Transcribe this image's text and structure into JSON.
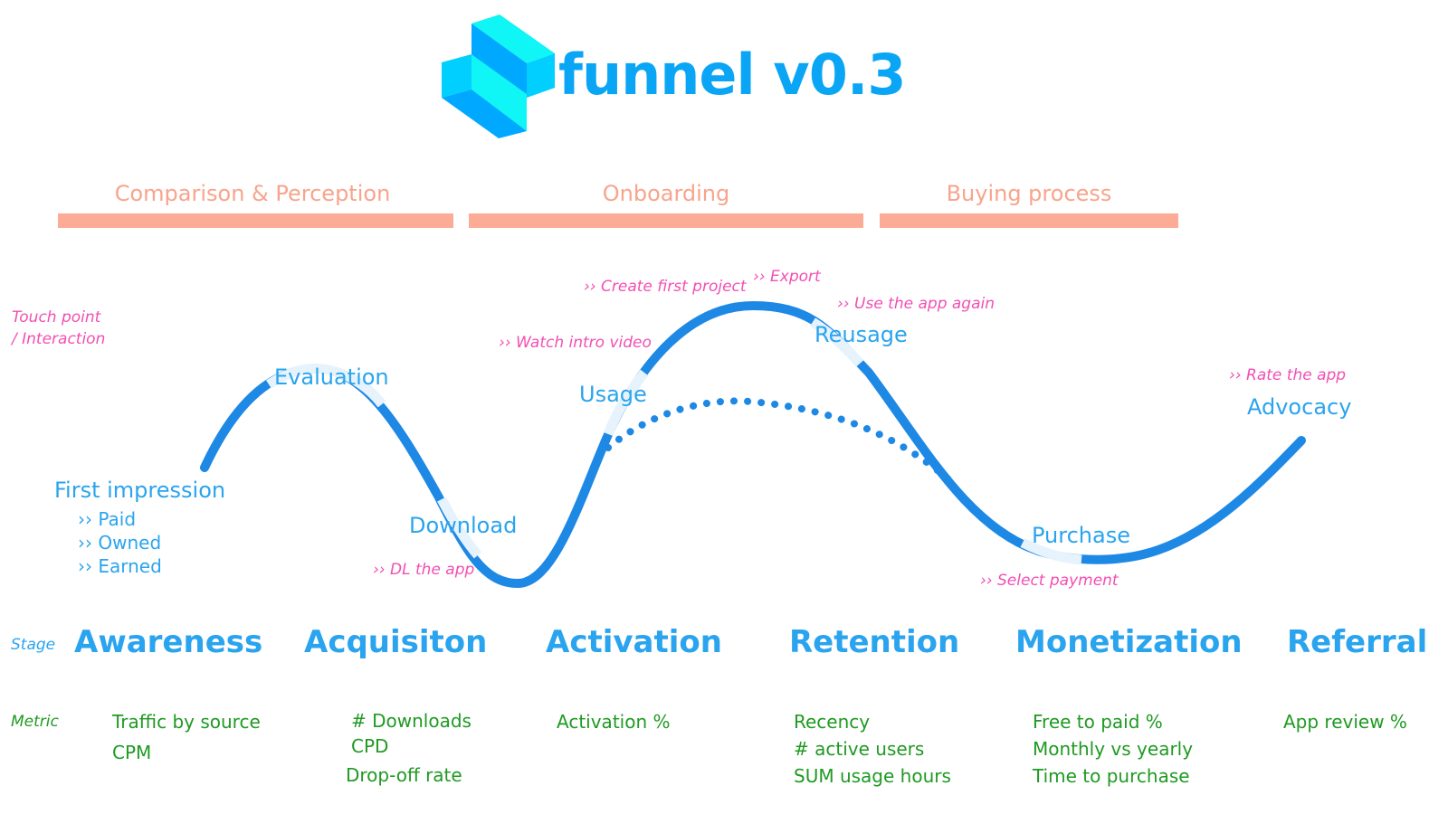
{
  "header": {
    "title": "funnel v0.3",
    "logo_icon": "isometric-blocks-logo"
  },
  "colors": {
    "curve": "#1e88e5",
    "label": "#2aa4ee",
    "touchpoint": "#f24fb4",
    "metric": "#1f9a22",
    "phase": "#fbab96"
  },
  "phases": [
    {
      "label": "Comparison & Perception"
    },
    {
      "label": "Onboarding"
    },
    {
      "label": "Buying process"
    }
  ],
  "side_labels": {
    "touchpoint_line1": "Touch point",
    "touchpoint_line2": "/ Interaction",
    "stage": "Stage",
    "metric": "Metric"
  },
  "curve_labels": {
    "first_impression": "First impression",
    "evaluation": "Evaluation",
    "download": "Download",
    "usage": "Usage",
    "reusage": "Reusage",
    "purchase": "Purchase",
    "advocacy": "Advocacy"
  },
  "channels": [
    "Paid",
    "Owned",
    "Earned"
  ],
  "touchpoints": {
    "dl": "DL the app",
    "intro": "Watch intro video",
    "create": "Create first project",
    "export": "Export",
    "again": "Use the app again",
    "rate": "Rate the app",
    "payment": "Select payment"
  },
  "stages": [
    "Awareness",
    "Acquisiton",
    "Activation",
    "Retention",
    "Monetization",
    "Referral"
  ],
  "metrics": {
    "awareness": [
      "Traffic by source",
      "CPM"
    ],
    "acquisition": [
      "# Downloads",
      "CPD",
      "Drop-off rate"
    ],
    "activation": [
      "Activation %"
    ],
    "retention": [
      "Recency",
      "# active users",
      "SUM usage hours"
    ],
    "monetization": [
      "Free to paid %",
      "Monthly vs yearly",
      "Time to purchase"
    ],
    "referral": [
      "App review %"
    ]
  }
}
